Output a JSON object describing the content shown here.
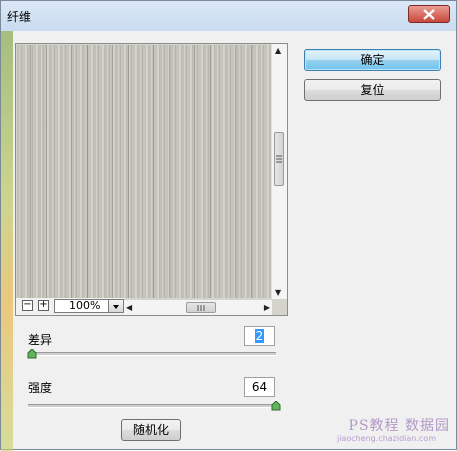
{
  "window": {
    "title": "纤维"
  },
  "buttons": {
    "ok": "确定",
    "reset": "复位",
    "randomize": "随机化"
  },
  "preview": {
    "zoom": "100%",
    "zoom_minus": "−",
    "zoom_plus": "+"
  },
  "variance": {
    "label": "差异",
    "value": "2",
    "min": 1,
    "max": 64,
    "slider_value": 2
  },
  "strength": {
    "label": "强度",
    "value": "64",
    "min": 1,
    "max": 64,
    "slider_value": 64
  },
  "watermark": {
    "text": "PS教程 数据园",
    "sub": "jiaocheng.chazidian.com"
  },
  "colors": {
    "primary_button": "#98d1ef",
    "fiber_base": "#c8c8bf"
  }
}
